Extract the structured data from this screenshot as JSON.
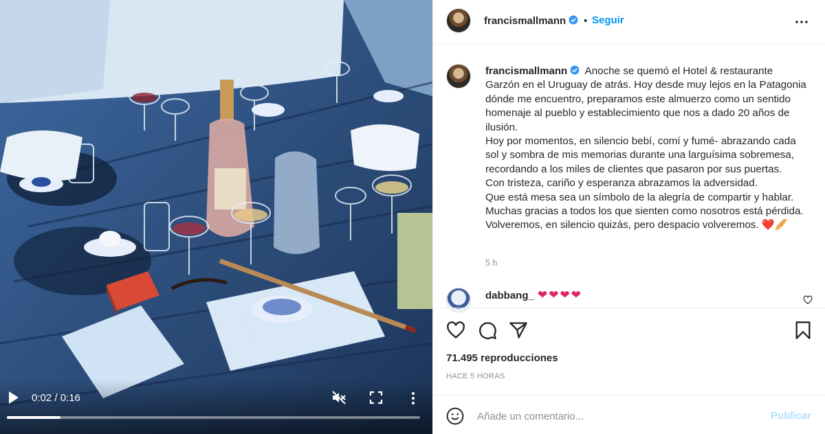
{
  "post": {
    "username": "francismallmann",
    "separator": "•",
    "follow_label": "Seguir",
    "caption_lines": [
      "Anoche se quemó el Hotel & restaurante Garzón en el Uruguay de atrás. Hoy desde muy lejos en la Patagonia dónde me encuentro, preparamos este almuerzo como un sentido homenaje al pueblo y establecimiento que nos a dado 20 años de ilusión.",
      "Hoy por momentos, en silencio bebí, comí y fumé- abrazando cada sol y sombra de mis memorias durante una larguísima sobremesa, recordando a los miles de clientes que pasaron por sus puertas.",
      "Con tristeza, cariño y esperanza abrazamos la adversidad.",
      "Que está mesa sea un símbolo de la alegría de compartir y hablar.",
      "Muchas gracias a todos los que sienten como nosotros está pérdida.",
      "Volveremos, en silencio quizás, pero despacio volveremos."
    ],
    "caption_emoji": "❤️🥖",
    "time_ago": "5 h",
    "views": "71.495 reproducciones",
    "posted": "HACE 5 HORAS"
  },
  "comment": {
    "username": "dabbang_",
    "text": "❤❤❤❤"
  },
  "add_comment": {
    "placeholder": "Añade un comentario...",
    "publish_label": "Publicar"
  },
  "video": {
    "time": "0:02 / 0:16",
    "progress": 0.13
  },
  "colors": {
    "accent": "#0095f6",
    "publish_disabled": "#b2dffc",
    "verified": "#3897f0",
    "heart": "#e0245e"
  },
  "icons": [
    "verified-icon",
    "more-icon",
    "play-icon",
    "mute-icon",
    "fullscreen-icon",
    "heart-icon",
    "comment-icon",
    "share-icon",
    "bookmark-icon",
    "smile-icon"
  ]
}
